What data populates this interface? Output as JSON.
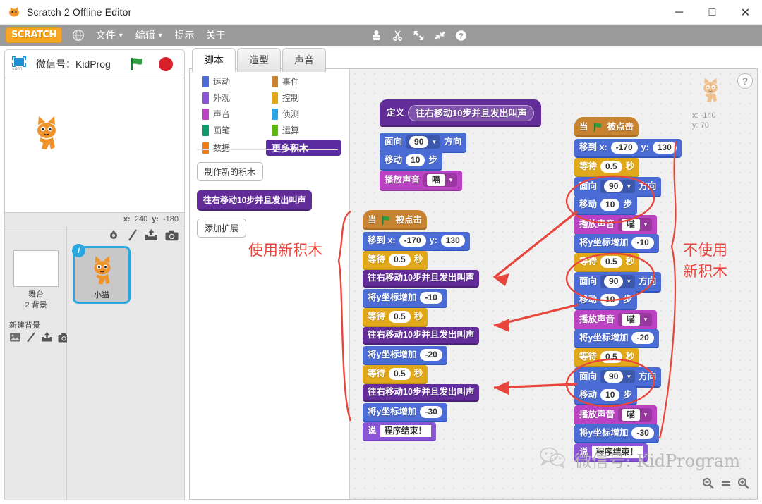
{
  "window": {
    "title": "Scratch 2 Offline Editor",
    "icon": "scratch-cat-icon",
    "minimize": "─",
    "maximize": "□",
    "close": "✕"
  },
  "menubar": {
    "logo": "SCRATCH",
    "globe_icon": "globe-icon",
    "items": [
      {
        "label": "文件",
        "has_caret": true
      },
      {
        "label": "编辑",
        "has_caret": true
      },
      {
        "label": "提示",
        "has_caret": false
      },
      {
        "label": "关于",
        "has_caret": false
      }
    ],
    "tools": [
      "stamp-icon",
      "scissors-icon",
      "grow-icon",
      "shrink-icon",
      "help-icon"
    ]
  },
  "stage_header": {
    "present_icon": "fullscreen-icon",
    "version": "v461",
    "project_name": "微信号：KidProg",
    "green_flag": "green-flag-icon",
    "stop": "stop-icon"
  },
  "stage_readout": {
    "x_label": "x:",
    "x_value": "240",
    "y_label": "y:",
    "y_value": "-180"
  },
  "sprite_pane": {
    "stage_label_line1": "舞台",
    "stage_label_line2": "2 背景",
    "new_backdrop_label": "新建背景",
    "new_backdrop_icons": [
      "library-icon",
      "paint-icon",
      "upload-icon",
      "camera-icon"
    ],
    "sprite_tools": [
      "new-sprite-icon",
      "paint-icon",
      "upload-icon",
      "camera-icon"
    ],
    "sprites": [
      {
        "name": "小猫",
        "badge": "i",
        "selected": true
      }
    ]
  },
  "tabs": [
    {
      "label": "脚本",
      "active": true
    },
    {
      "label": "造型",
      "active": false
    },
    {
      "label": "声音",
      "active": false
    }
  ],
  "palette": {
    "categories": [
      {
        "label": "运动",
        "color": "#4a6cd4",
        "selected": false
      },
      {
        "label": "事件",
        "color": "#c88330",
        "selected": false
      },
      {
        "label": "外观",
        "color": "#8a55d7",
        "selected": false
      },
      {
        "label": "控制",
        "color": "#e1a91a",
        "selected": false
      },
      {
        "label": "声音",
        "color": "#bb42c3",
        "selected": false
      },
      {
        "label": "侦测",
        "color": "#2ca5e2",
        "selected": false
      },
      {
        "label": "画笔",
        "color": "#0e9a6c",
        "selected": false
      },
      {
        "label": "运算",
        "color": "#5cb712",
        "selected": false
      },
      {
        "label": "数据",
        "color": "#ee7d16",
        "selected": false
      },
      {
        "label": "更多积木",
        "color": "#632d99",
        "selected": true
      }
    ],
    "make_block_button": "制作新的积木",
    "custom_block": "往右移动10步并且发出叫声",
    "add_extension_button": "添加扩展"
  },
  "script_area": {
    "help_icon": "help-icon",
    "sprite_x_label": "x:",
    "sprite_x_value": "-140",
    "sprite_y_label": "y:",
    "sprite_y_value": "70",
    "zoom_out_icon": "zoom-out-icon",
    "zoom_reset_icon": "zoom-reset-icon",
    "zoom_in_icon": "zoom-in-icon"
  },
  "define_script": {
    "define_label": "定义",
    "prototype": "往右移动10步并且发出叫声",
    "blocks": [
      {
        "category": "motion",
        "parts": [
          "面向",
          {
            "drop": "90"
          },
          "方向"
        ]
      },
      {
        "category": "motion",
        "parts": [
          "移动",
          {
            "oval": "10"
          },
          "步"
        ]
      },
      {
        "category": "sound",
        "parts": [
          "播放声音",
          {
            "drop": "喵"
          }
        ]
      }
    ]
  },
  "left_script": {
    "hat": {
      "pre": "当",
      "icon": "green-flag-icon",
      "post": "被点击"
    },
    "blocks": [
      {
        "category": "motion",
        "parts": [
          "移到 x:",
          {
            "oval": "-170"
          },
          "y:",
          {
            "oval": "130"
          }
        ]
      },
      {
        "category": "control",
        "parts": [
          "等待",
          {
            "oval": "0.5"
          },
          "秒"
        ]
      },
      {
        "category": "more",
        "parts": [
          "往右移动10步并且发出叫声"
        ]
      },
      {
        "category": "motion",
        "parts": [
          "将y坐标增加",
          {
            "oval": "-10"
          }
        ]
      },
      {
        "category": "control",
        "parts": [
          "等待",
          {
            "oval": "0.5"
          },
          "秒"
        ]
      },
      {
        "category": "more",
        "parts": [
          "往右移动10步并且发出叫声"
        ]
      },
      {
        "category": "motion",
        "parts": [
          "将y坐标增加",
          {
            "oval": "-20"
          }
        ]
      },
      {
        "category": "control",
        "parts": [
          "等待",
          {
            "oval": "0.5"
          },
          "秒"
        ]
      },
      {
        "category": "more",
        "parts": [
          "往右移动10步并且发出叫声"
        ]
      },
      {
        "category": "motion",
        "parts": [
          "将y坐标增加",
          {
            "oval": "-30"
          }
        ]
      },
      {
        "category": "looks",
        "parts": [
          "说",
          {
            "rect": "程序结束！"
          }
        ]
      }
    ]
  },
  "right_script": {
    "hat": {
      "pre": "当",
      "icon": "green-flag-icon",
      "post": "被点击"
    },
    "blocks": [
      {
        "category": "motion",
        "parts": [
          "移到 x:",
          {
            "oval": "-170"
          },
          "y:",
          {
            "oval": "130"
          }
        ]
      },
      {
        "category": "control",
        "parts": [
          "等待",
          {
            "oval": "0.5"
          },
          "秒"
        ]
      },
      {
        "category": "motion",
        "parts": [
          "面向",
          {
            "drop": "90"
          },
          "方向"
        ]
      },
      {
        "category": "motion",
        "parts": [
          "移动",
          {
            "oval": "10"
          },
          "步"
        ]
      },
      {
        "category": "sound",
        "parts": [
          "播放声音",
          {
            "drop": "喵"
          }
        ]
      },
      {
        "category": "motion",
        "parts": [
          "将y坐标增加",
          {
            "oval": "-10"
          }
        ]
      },
      {
        "category": "control",
        "parts": [
          "等待",
          {
            "oval": "0.5"
          },
          "秒"
        ]
      },
      {
        "category": "motion",
        "parts": [
          "面向",
          {
            "drop": "90"
          },
          "方向"
        ]
      },
      {
        "category": "motion",
        "parts": [
          "移动",
          {
            "oval": "10"
          },
          "步"
        ]
      },
      {
        "category": "sound",
        "parts": [
          "播放声音",
          {
            "drop": "喵"
          }
        ]
      },
      {
        "category": "motion",
        "parts": [
          "将y坐标增加",
          {
            "oval": "-20"
          }
        ]
      },
      {
        "category": "control",
        "parts": [
          "等待",
          {
            "oval": "0.5"
          },
          "秒"
        ]
      },
      {
        "category": "motion",
        "parts": [
          "面向",
          {
            "drop": "90"
          },
          "方向"
        ]
      },
      {
        "category": "motion",
        "parts": [
          "移动",
          {
            "oval": "10"
          },
          "步"
        ]
      },
      {
        "category": "sound",
        "parts": [
          "播放声音",
          {
            "drop": "喵"
          }
        ]
      },
      {
        "category": "motion",
        "parts": [
          "将y坐标增加",
          {
            "oval": "-30"
          }
        ]
      },
      {
        "category": "looks",
        "parts": [
          "说",
          {
            "rect": "程序结束！"
          }
        ]
      }
    ]
  },
  "annotations": {
    "color": "#e8453c",
    "left_label": "使用新积木",
    "right_label_line1": "不使用",
    "right_label_line2": "新积木"
  },
  "watermark": {
    "icon": "wechat-icon",
    "text": "微信号: KidProgram"
  }
}
